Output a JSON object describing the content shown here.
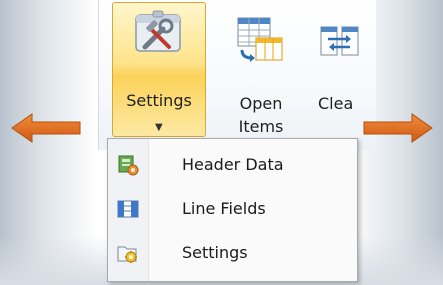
{
  "ribbon": {
    "settings_button": {
      "label": "Settings",
      "icon": "tools-icon"
    },
    "open_items_button": {
      "label_line1": "Open",
      "label_line2": "Items",
      "icon": "table-icon"
    },
    "clear_button": {
      "label": "Clea",
      "icon": "transfer-icon"
    }
  },
  "dropdown": {
    "items": [
      {
        "label": "Header Data",
        "icon": "header-data-icon"
      },
      {
        "label": "Line Fields",
        "icon": "line-fields-icon"
      },
      {
        "label": "Settings",
        "icon": "settings-folder-icon"
      }
    ]
  },
  "decor": {
    "arrow_color": "#e2691f",
    "accent_highlight": "#fbd25a"
  }
}
